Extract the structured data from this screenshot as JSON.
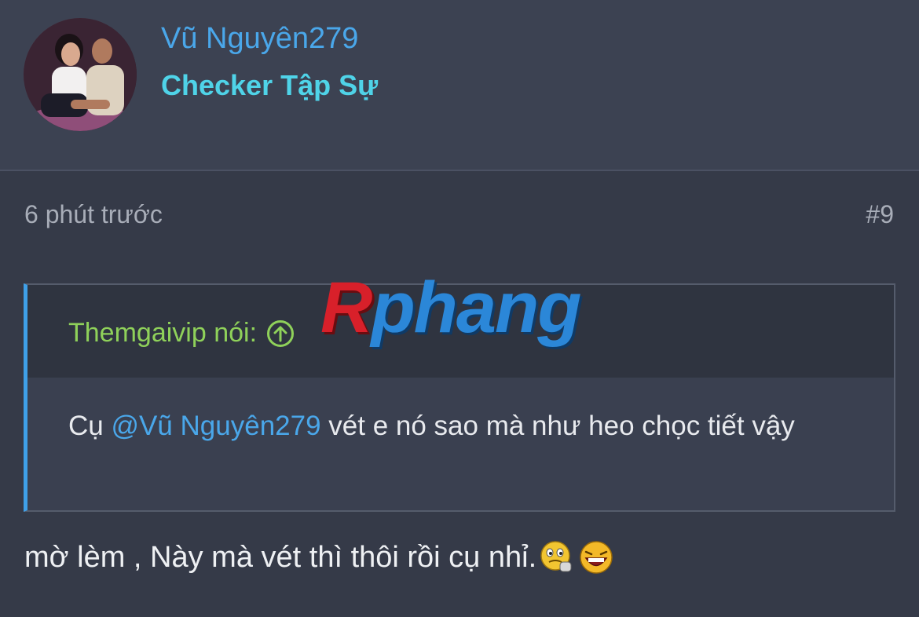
{
  "user": {
    "name": "Vũ Nguyên279",
    "title": "Checker Tập Sự"
  },
  "post": {
    "time": "6 phút trước",
    "number": "#9",
    "quote": {
      "author": "Themgaivip nói:",
      "text_before": "Cụ ",
      "mention": "@Vũ Nguyên279",
      "text_after": " vét e nó sao mà như heo chọc tiết vậy"
    },
    "text": "mờ lèm , Này mà vét thì thôi rồi cụ nhỉ."
  },
  "watermark": {
    "first": "R",
    "rest": "phang"
  },
  "icons": {
    "quote_up": "arrow-up-circle-icon",
    "smiley1": "thinking-smiley-icon",
    "smiley2": "laughing-smiley-icon"
  },
  "colors": {
    "background": "#353a48",
    "header_bg": "#3c4252",
    "username": "#4aa7ea",
    "user_title": "#4fd3e8",
    "quote_author": "#8fd15a",
    "quote_border": "#3fa0e8"
  }
}
